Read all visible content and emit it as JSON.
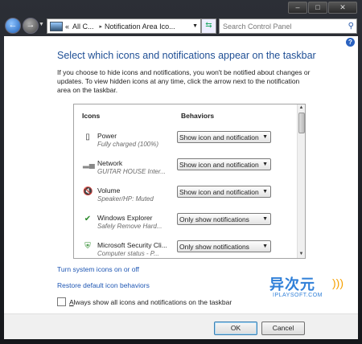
{
  "window": {
    "minimize_glyph": "–",
    "maximize_glyph": "□",
    "close_glyph": "✕"
  },
  "nav": {
    "back_icon": "back-arrow-icon",
    "forward_icon": "forward-arrow-icon",
    "address": {
      "breadcrumb_prefix": "«",
      "segments": [
        "All C...",
        "Notification Area Ico..."
      ]
    },
    "search_placeholder": "Search Control Panel"
  },
  "main": {
    "title": "Select which icons and notifications appear on the taskbar",
    "description": "If you choose to hide icons and notifications, you won't be notified about changes or updates. To view hidden icons at any time, click the arrow next to the notification area on the taskbar.",
    "columns": {
      "icons": "Icons",
      "behaviors": "Behaviors"
    },
    "rows": [
      {
        "name": "Power",
        "subtitle": "Fully charged (100%)",
        "behavior": "Show icon and notification",
        "icon": "battery-icon"
      },
      {
        "name": "Network",
        "subtitle": "GUITAR HOUSE Inter...",
        "behavior": "Show icon and notification",
        "icon": "network-signal-icon"
      },
      {
        "name": "Volume",
        "subtitle": "Speaker/HP: Muted",
        "behavior": "Show icon and notification",
        "icon": "speaker-muted-icon"
      },
      {
        "name": "Windows Explorer",
        "subtitle": "Safely Remove Hard...",
        "behavior": "Only show notifications",
        "icon": "usb-device-icon"
      },
      {
        "name": "Microsoft Security Cli...",
        "subtitle": "Computer status - P...",
        "behavior": "Only show notifications",
        "icon": "security-shield-icon"
      }
    ],
    "links": {
      "system_icons": "Turn system icons on or off",
      "restore": "Restore default icon behaviors"
    },
    "always_show": {
      "underlined": "A",
      "rest": "lways show all icons and notifications on the taskbar",
      "checked": false
    }
  },
  "footer": {
    "ok": "OK",
    "cancel": "Cancel"
  },
  "watermark": {
    "top": "异次元",
    "bottom": "IPLAYSOFT.COM"
  }
}
